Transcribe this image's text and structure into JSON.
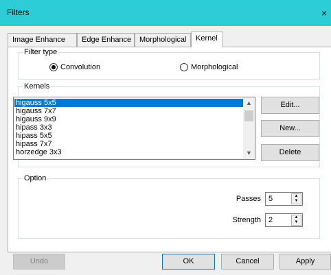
{
  "window": {
    "title": "Filters",
    "close_glyph": "×"
  },
  "tabs": [
    {
      "label": "Image Enhance",
      "active": false
    },
    {
      "label": "Edge Enhance",
      "active": false
    },
    {
      "label": "Morphological",
      "active": false
    },
    {
      "label": "Kernel",
      "active": true
    }
  ],
  "filter_type": {
    "label": "Filter type",
    "options": [
      {
        "label": "Convolution",
        "checked": true
      },
      {
        "label": "Morphological",
        "checked": false
      }
    ]
  },
  "kernels": {
    "label": "Kernels",
    "items": [
      "higauss 5x5",
      "higauss 7x7",
      "higauss 9x9",
      "hipass 3x3",
      "hipass 5x5",
      "hipass 7x7",
      "horzedge 3x3"
    ],
    "selected": "higauss 5x5",
    "buttons": {
      "edit": "Edit...",
      "new": "New...",
      "delete": "Delete"
    }
  },
  "option": {
    "label": "Option",
    "passes": {
      "label": "Passes",
      "value": "5"
    },
    "strength": {
      "label": "Strength",
      "value": "2"
    }
  },
  "footer": {
    "undo": "Undo",
    "ok": "OK",
    "cancel": "Cancel",
    "apply": "Apply"
  },
  "colors": {
    "titlebar": "#2ccdd6",
    "selection": "#0078d7",
    "focus_border": "#0078d7"
  }
}
